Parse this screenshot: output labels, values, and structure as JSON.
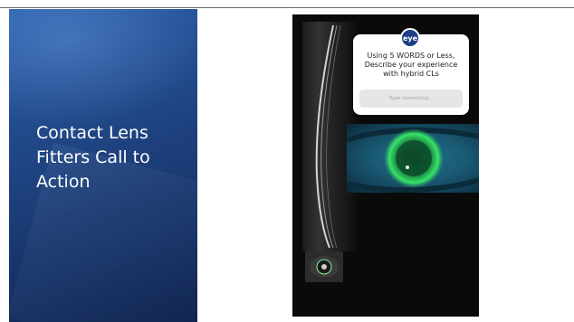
{
  "slide": {
    "title": "Contact Lens Fitters Call to Action"
  },
  "story": {
    "logo_text": "eye",
    "prompt": "Using 5 WORDS or Less, Describe your experience with hybrid CLs",
    "input_placeholder": "Type something..."
  },
  "colors": {
    "panel_top": "#2b5fae",
    "panel_bottom": "#0f2450",
    "logo": "#1d3f86",
    "fluorescein": "#39e36a"
  },
  "icons": {
    "logo": "eye-logo-icon"
  }
}
